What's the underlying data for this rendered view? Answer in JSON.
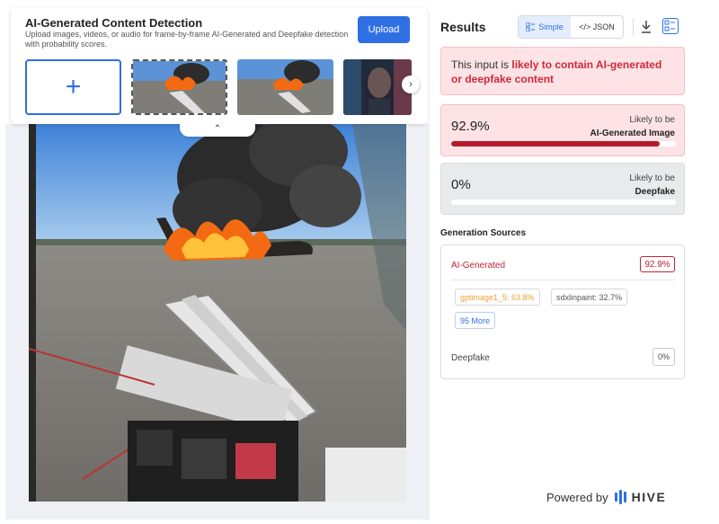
{
  "detector": {
    "title": "AI-Generated Content Detection",
    "subtitle": "Upload images, videos, or audio for frame-by-frame AI-Generated and Deepfake detection with probability scores.",
    "upload_label": "Upload",
    "add_symbol": "+",
    "next_symbol": "›",
    "collapse_symbol": "⌃"
  },
  "results": {
    "title": "Results",
    "view_simple": "Simple",
    "view_json": "</> JSON",
    "verdict_prefix": "This input is ",
    "verdict_emphasis": "likely to contain AI-generated or deepfake content",
    "ai_score": {
      "percent_text": "92.9%",
      "value": 0.929,
      "label_top": "Likely to be",
      "label_bottom": "AI-Generated Image"
    },
    "deepfake_score": {
      "percent_text": "0%",
      "value": 0.0,
      "label_top": "Likely to be",
      "label_bottom": "Deepfake"
    }
  },
  "sources": {
    "title": "Generation Sources",
    "ai_label": "AI-Generated",
    "ai_value": "92.9%",
    "chips": [
      "gptimage1_5: 63.8%",
      "sdxlinpaint: 32.7%"
    ],
    "more_label": "95 More",
    "deepfake_label": "Deepfake",
    "deepfake_value": "0%"
  },
  "footer": {
    "powered_by": "Powered by",
    "brand": "HIVE"
  },
  "colors": {
    "accent": "#2f6fe4",
    "danger": "#d0293a",
    "danger_bg": "#fde3e5"
  }
}
